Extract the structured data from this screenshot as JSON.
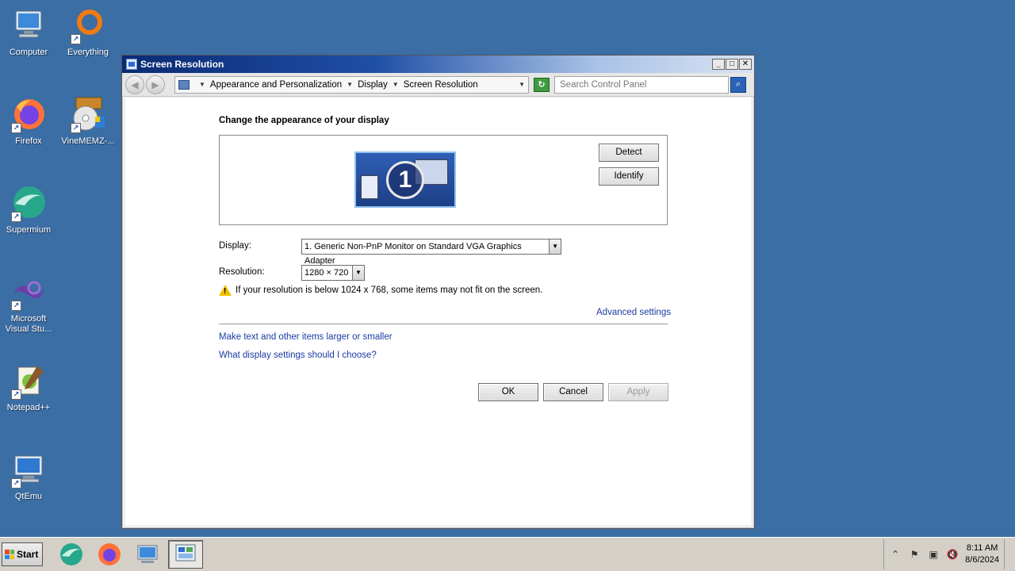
{
  "desktop": {
    "icons": [
      {
        "label": "Computer"
      },
      {
        "label": "Everything"
      },
      {
        "label": "Firefox"
      },
      {
        "label": "VineMEMZ-..."
      },
      {
        "label": "Supermium"
      },
      {
        "label": "Microsoft\nVisual Stu..."
      },
      {
        "label": "Notepad++"
      },
      {
        "label": "QtEmu"
      }
    ]
  },
  "window": {
    "title": "Screen Resolution",
    "controls": {
      "minimize": "_",
      "maximize": "□",
      "close": "✕"
    },
    "breadcrumb": [
      "Appearance and Personalization",
      "Display",
      "Screen Resolution"
    ],
    "search_placeholder": "Search Control Panel",
    "heading": "Change the appearance of your display",
    "monitor_number": "1",
    "detect_label": "Detect",
    "identify_label": "Identify",
    "display_label": "Display:",
    "display_value": "1. Generic Non-PnP Monitor on Standard VGA Graphics Adapter",
    "resolution_label": "Resolution:",
    "resolution_value": "1280 × 720",
    "warning_text": "If your resolution is below 1024 x 768, some items may not fit on the screen.",
    "advanced_link": "Advanced settings",
    "links": [
      "Make text and other items larger or smaller",
      "What display settings should I choose?"
    ],
    "ok_label": "OK",
    "cancel_label": "Cancel",
    "apply_label": "Apply"
  },
  "taskbar": {
    "start_label": "Start",
    "clock_time": "8:11 AM",
    "clock_date": "8/6/2024"
  },
  "colors": {
    "desktop_bg": "#3a6ea5",
    "title_gradient_start": "#0b2a73",
    "link": "#1a3aa3"
  }
}
